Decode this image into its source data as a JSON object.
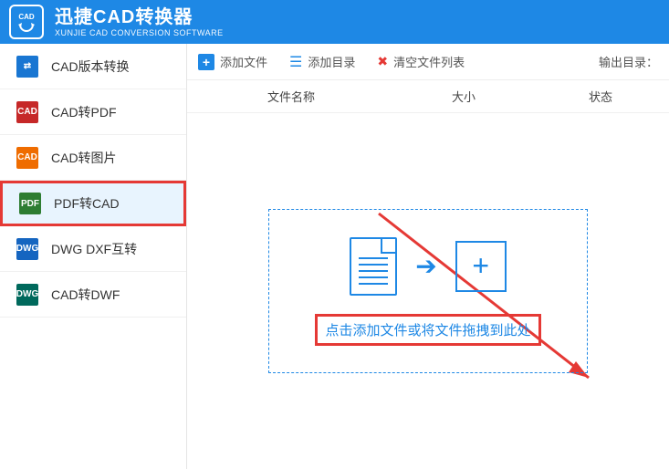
{
  "header": {
    "title": "迅捷CAD转换器",
    "subtitle": "XUNJIE CAD CONVERSION SOFTWARE",
    "logo_text": "CAD"
  },
  "sidebar": {
    "items": [
      {
        "label": "CAD版本转换",
        "icon": "⇄"
      },
      {
        "label": "CAD转PDF",
        "icon": "CAD"
      },
      {
        "label": "CAD转图片",
        "icon": "CAD"
      },
      {
        "label": "PDF转CAD",
        "icon": "PDF"
      },
      {
        "label": "DWG DXF互转",
        "icon": "DWG"
      },
      {
        "label": "CAD转DWF",
        "icon": "DWG"
      }
    ]
  },
  "toolbar": {
    "add_file": "添加文件",
    "add_dir": "添加目录",
    "clear_list": "清空文件列表",
    "output_dir": "输出目录："
  },
  "columns": {
    "name": "文件名称",
    "size": "大小",
    "status": "状态"
  },
  "dropzone": {
    "text": "点击添加文件或将文件拖拽到此处"
  }
}
